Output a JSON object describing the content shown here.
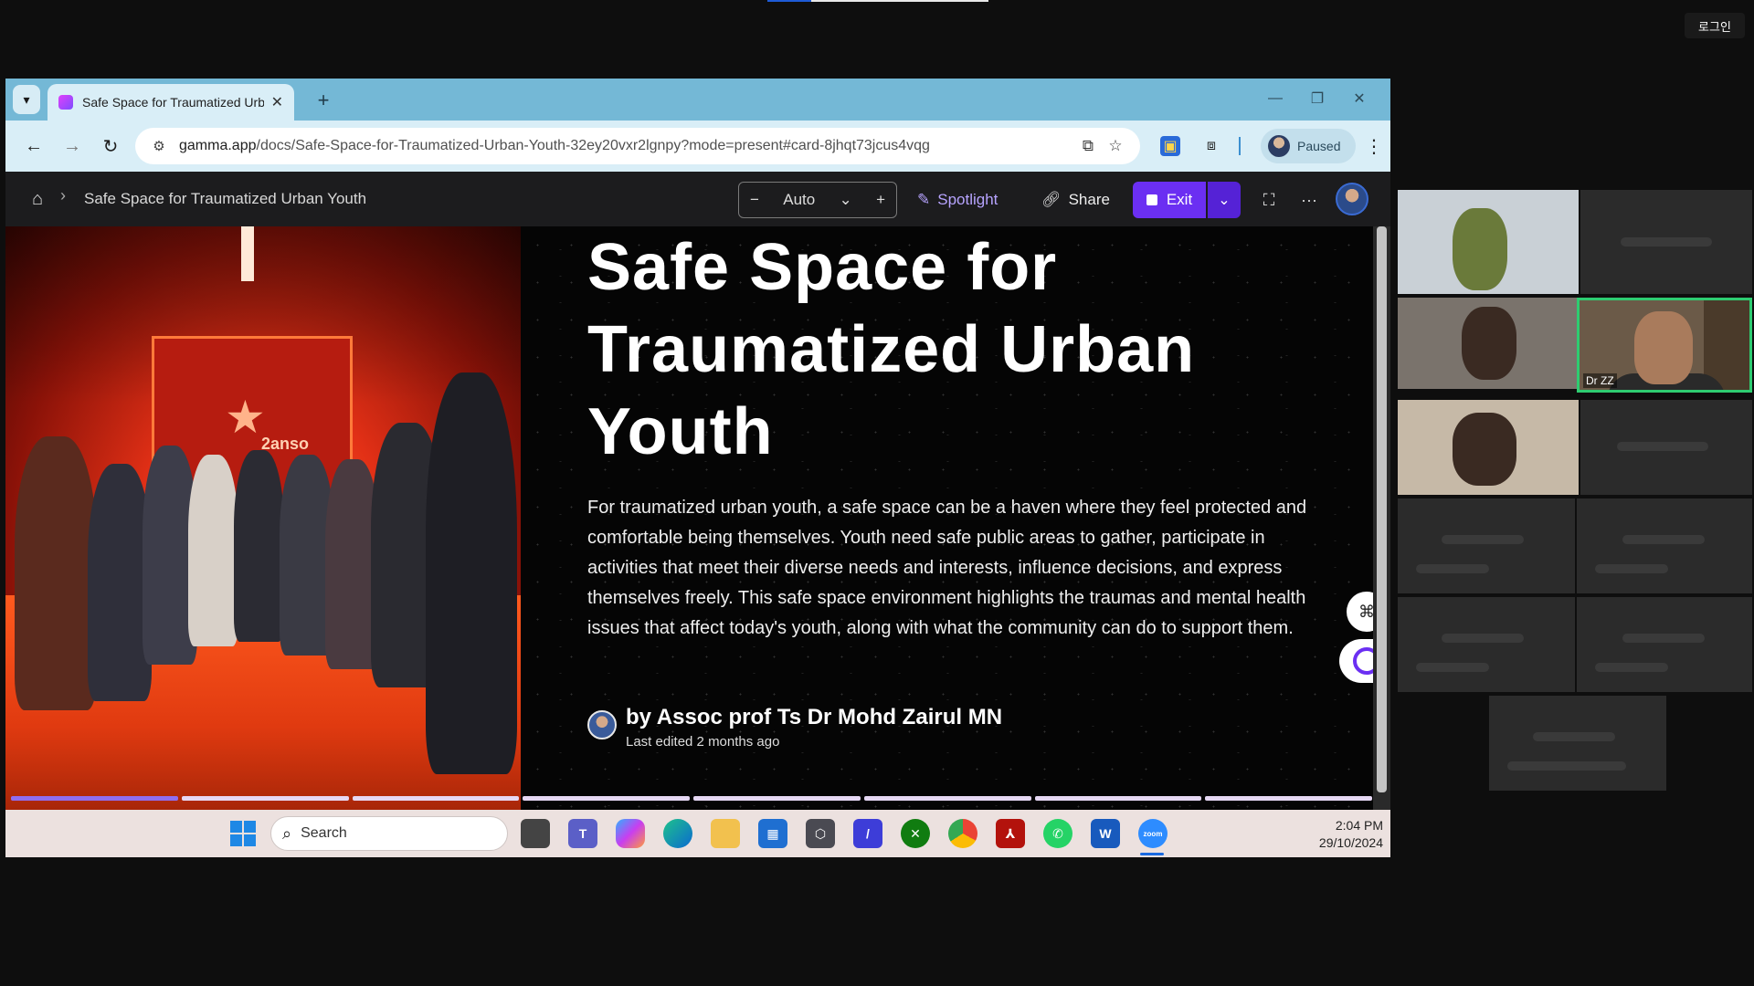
{
  "zoom": {
    "login_label": "로그인",
    "participant_label": "Dr ZZ"
  },
  "browser": {
    "tab_title": "Safe Space for Traumatized Urb",
    "url_host": "gamma.app",
    "url_path": "/docs/Safe-Space-for-Traumatized-Urban-Youth-32ey20vxr2lgnpy?mode=present#card-8jhqt73jcus4vqg",
    "profile_status": "Paused"
  },
  "gamma": {
    "breadcrumb": "Safe Space for Traumatized Urban Youth",
    "zoom_value": "Auto",
    "spotlight_label": "Spotlight",
    "share_label": "Share",
    "exit_label": "Exit"
  },
  "slide": {
    "title": "Safe Space for Traumatized Urban Youth",
    "body": "For traumatized urban youth, a safe space can be a haven where they feel protected and comfortable being themselves. Youth need safe public areas to gather, participate in activities that meet their diverse needs and interests, influence decisions, and express themselves freely. This safe space environment highlights the traumas and mental health issues that affect today's youth, along with what the community can do to support them.",
    "author": "by Assoc prof Ts Dr Mohd Zairul MN",
    "last_edited": "Last edited 2 months ago",
    "image_wall_text": "2anso",
    "progress_segments": 8,
    "progress_active_index": 0
  },
  "taskbar": {
    "search_placeholder": "Search",
    "time": "2:04 PM",
    "date": "29/10/2024",
    "apps": [
      "task-view",
      "teams",
      "copilot",
      "edge",
      "file-explorer",
      "microsoft-store",
      "app-cube",
      "editor",
      "xbox",
      "chrome",
      "acrobat",
      "whatsapp",
      "word",
      "zoom"
    ]
  },
  "colors": {
    "tabbar": "#74b8d6",
    "toolbar": "#d9eef7",
    "accent_purple": "#6b2ff2",
    "active_speaker": "#2ecc71"
  }
}
